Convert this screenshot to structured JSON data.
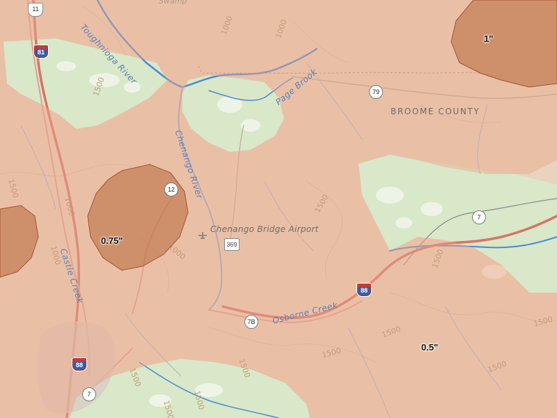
{
  "map": {
    "water_labels": {
      "susquehanna": "Toughnioga River",
      "chenango": "Chenango River",
      "page_brook": "Page Brook",
      "castle_creek": "Castle Creek",
      "osborne_creek": "Osborne Creek"
    },
    "places": {
      "airport": "Chenango Bridge Airport",
      "county": "BROOME COUNTY",
      "swamp": "Swamp"
    },
    "contours": [
      "1000",
      "1000",
      "1500",
      "1500",
      "1000",
      "1500",
      "1000",
      "1500",
      "1500",
      "1500",
      "1500",
      "1500",
      "1500",
      "1000",
      "1500",
      "1500",
      "1500"
    ],
    "shields": {
      "us11": "11",
      "i81": "81",
      "ny79": "79",
      "ny12": "12",
      "ny7_east": "7",
      "ny7_south": "7",
      "cr369": "369",
      "i88_east": "88",
      "i88_west": "88",
      "ny7b": "7B"
    },
    "overlay_amounts": {
      "northeast": "1\"",
      "west_center": "0.75\"",
      "southeast": "0.5\""
    },
    "colors": {
      "land": "#e9d3bd",
      "forest": "#d6e9c6",
      "snow_overlay": "#a0522d",
      "water": "#4a88d8",
      "highway": "#d9736a",
      "major_road": "#e59d93"
    }
  }
}
